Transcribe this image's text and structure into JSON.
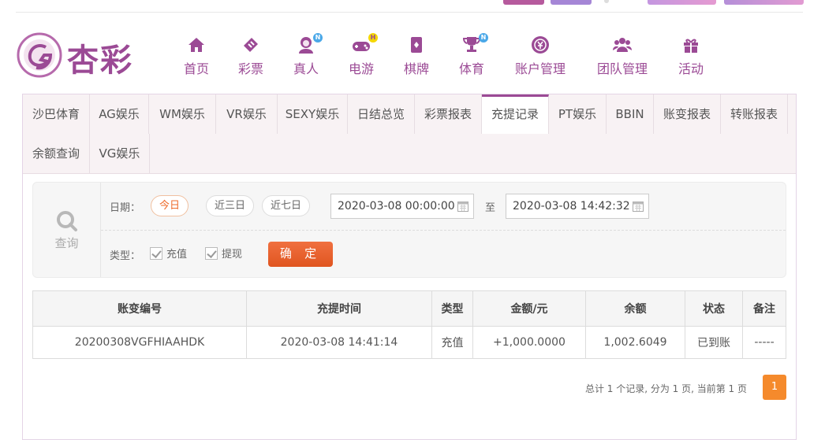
{
  "brand": {
    "name": "杏彩"
  },
  "nav": [
    {
      "label": "首页",
      "icon": "home-icon"
    },
    {
      "label": "彩票",
      "icon": "ticket-icon"
    },
    {
      "label": "真人",
      "icon": "live-dealer-icon",
      "badge": "N"
    },
    {
      "label": "电游",
      "icon": "gamepad-icon",
      "badge": "H"
    },
    {
      "label": "棋牌",
      "icon": "cards-icon"
    },
    {
      "label": "体育",
      "icon": "trophy-icon",
      "badge": "N"
    },
    {
      "label": "账户管理",
      "icon": "yen-coin-icon"
    },
    {
      "label": "团队管理",
      "icon": "team-icon"
    },
    {
      "label": "活动",
      "icon": "gift-icon"
    }
  ],
  "tabs": [
    "沙巴体育",
    "AG娱乐",
    "WM娱乐",
    "VR娱乐",
    "SEXY娱乐",
    "日结总览",
    "彩票报表",
    "充提记录",
    "PT娱乐",
    "BBIN",
    "账变报表",
    "转账报表",
    "余额查询",
    "VG娱乐"
  ],
  "active_tab": "充提记录",
  "search": {
    "side_label": "查询",
    "date_label": "日期：",
    "ranges": [
      "今日",
      "近三日",
      "近七日"
    ],
    "active_range": "今日",
    "start": "2020-03-08 00:00:00",
    "to_label": "至",
    "end": "2020-03-08 14:42:32",
    "type_label": "类型：",
    "types": [
      "充值",
      "提现"
    ],
    "submit": "确 定"
  },
  "table": {
    "headers": [
      "账变编号",
      "充提时间",
      "类型",
      "金额/元",
      "余额",
      "状态",
      "备注"
    ],
    "rows": [
      [
        "20200308VGFHIAAHDK",
        "2020-03-08 14:41:14",
        "充值",
        "+1,000.0000",
        "1,002.6049",
        "已到账",
        "-----"
      ]
    ]
  },
  "pagination": {
    "summary": "总计 1 个记录, 分为 1 页, 当前第 1 页",
    "current": "1"
  },
  "colors": {
    "brand_purple": "#9b4a95",
    "accent_orange": "#ee6a2a",
    "amount_red": "#d0021b",
    "status_green": "#3aa02b"
  }
}
